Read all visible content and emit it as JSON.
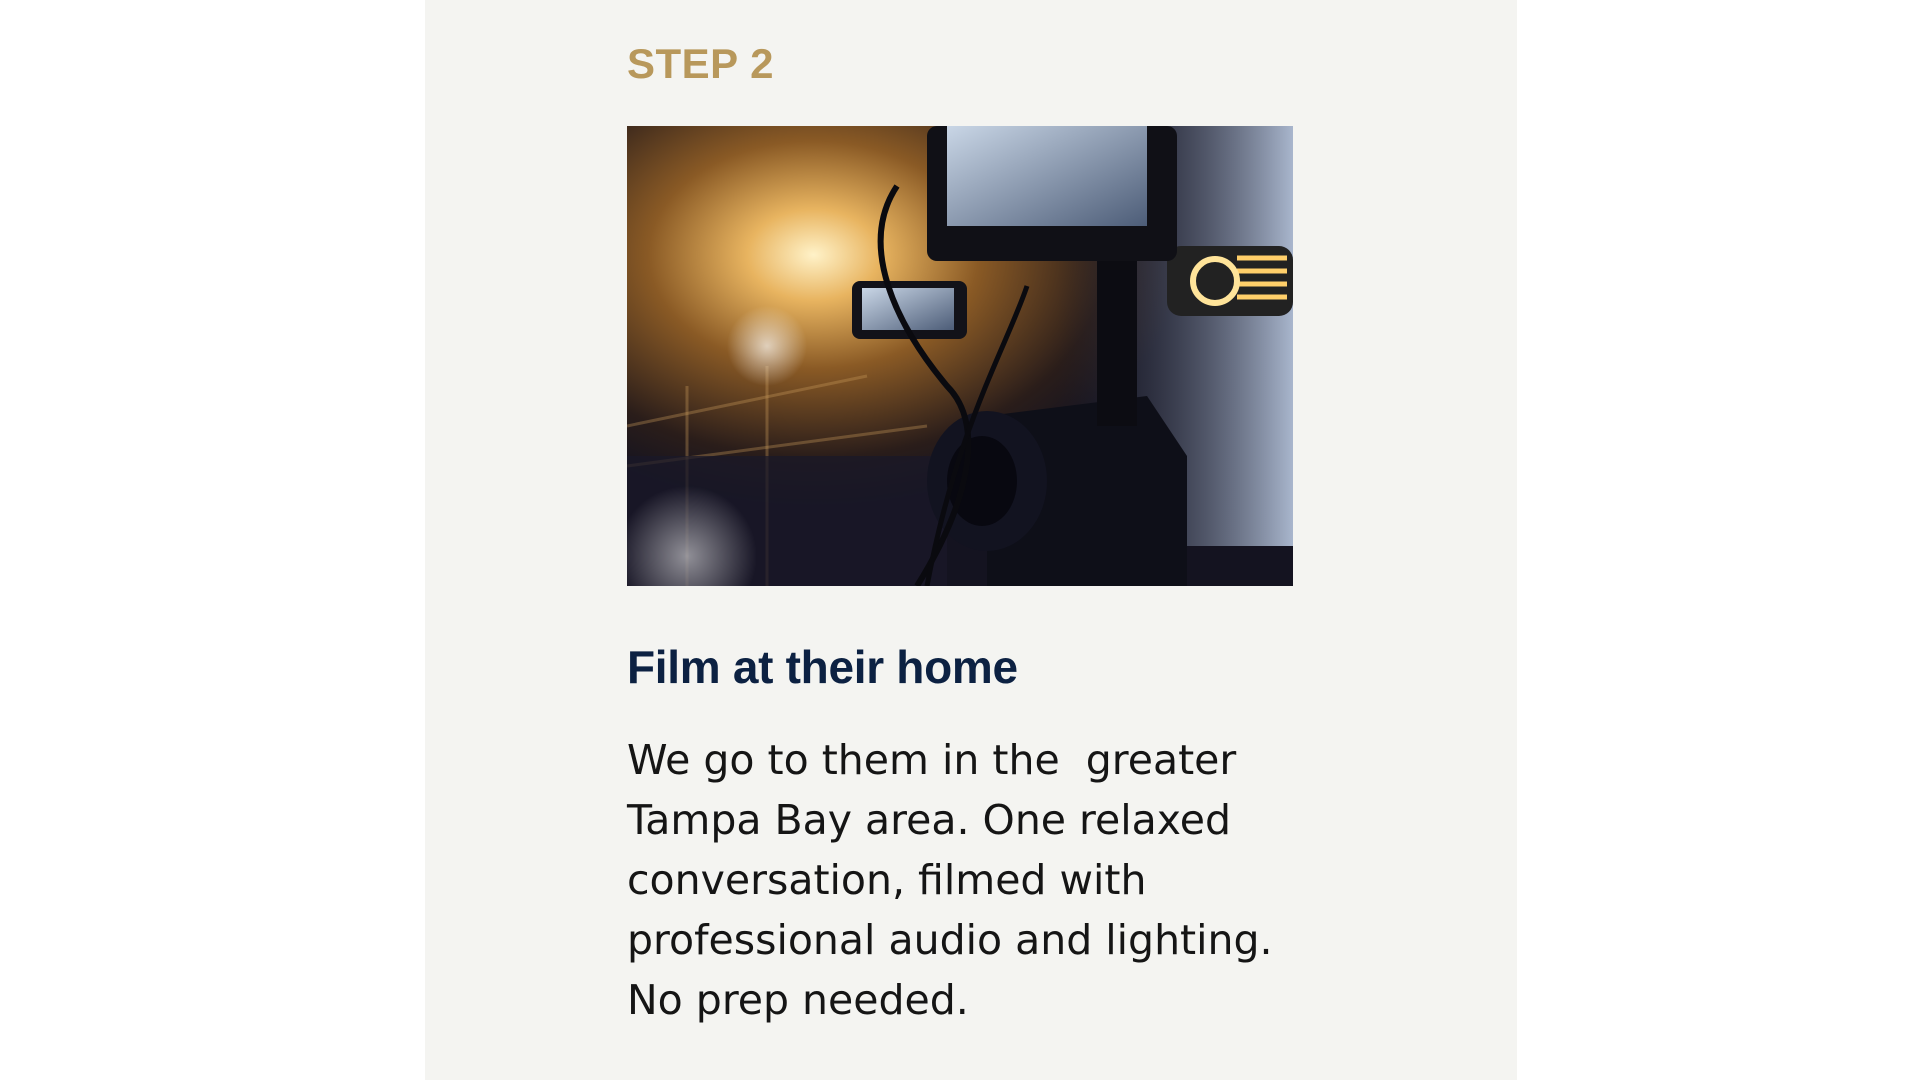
{
  "step": {
    "label": "STEP 2"
  },
  "photo": {
    "subject": "camera-rig-image"
  },
  "section": {
    "title": "Film at their home",
    "body_lines": [
      "We go to them in the  greater",
      "Tampa Bay area. One relaxed",
      "conversation, filmed with",
      "professional audio and lighting.",
      "No prep needed."
    ]
  },
  "colors": {
    "card_background": "#f4f4f1",
    "step_accent": "#b8985b",
    "title_navy": "#0c2142",
    "body_text": "#151515"
  }
}
